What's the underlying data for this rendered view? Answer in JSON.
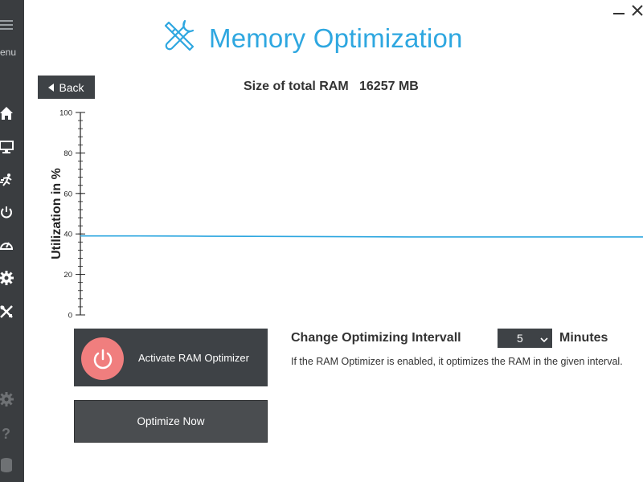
{
  "sidebar": {
    "menu_label": "Menu",
    "items": [
      {
        "icon": "home-icon"
      },
      {
        "icon": "monitor-icon"
      },
      {
        "icon": "running-person-icon"
      },
      {
        "icon": "power-icon"
      },
      {
        "icon": "speedometer-icon"
      },
      {
        "icon": "gear-icon"
      },
      {
        "icon": "tools-icon"
      }
    ],
    "bottom_items": [
      {
        "icon": "settings-icon"
      },
      {
        "icon": "help-icon"
      },
      {
        "icon": "database-icon"
      }
    ]
  },
  "window": {
    "minimize_icon": "minimize-icon",
    "close_icon": "close-icon"
  },
  "header": {
    "title": "Memory Optimization",
    "icon": "tools-icon",
    "accent": "#2ea7e0"
  },
  "back_button": {
    "label": "Back"
  },
  "ram": {
    "label": "Size of total RAM",
    "value": "16257 MB",
    "text": "Size of total RAM   16257 MB"
  },
  "chart_data": {
    "type": "line",
    "ylabel": "Utilization in %",
    "xlabel": "",
    "ylim": [
      0,
      100
    ],
    "yticks": [
      0,
      20,
      40,
      60,
      80,
      100
    ],
    "series": [
      {
        "color": "#2ea7e0",
        "values": [
          39,
          39,
          38.9,
          38.8,
          38.7,
          38.6,
          38.5,
          38.5,
          38.5,
          38.5,
          38.5
        ]
      }
    ]
  },
  "actions": {
    "activate_label": "Activate RAM Optimizer",
    "activate_icon": "power-icon",
    "activate_icon_color": "#f07e7e",
    "optimize_label": "Optimize Now"
  },
  "interval": {
    "label": "Change Optimizing Intervall",
    "value": "5",
    "unit": "Minutes",
    "description": "If the RAM Optimizer is enabled, it optimizes the RAM in the given interval."
  }
}
